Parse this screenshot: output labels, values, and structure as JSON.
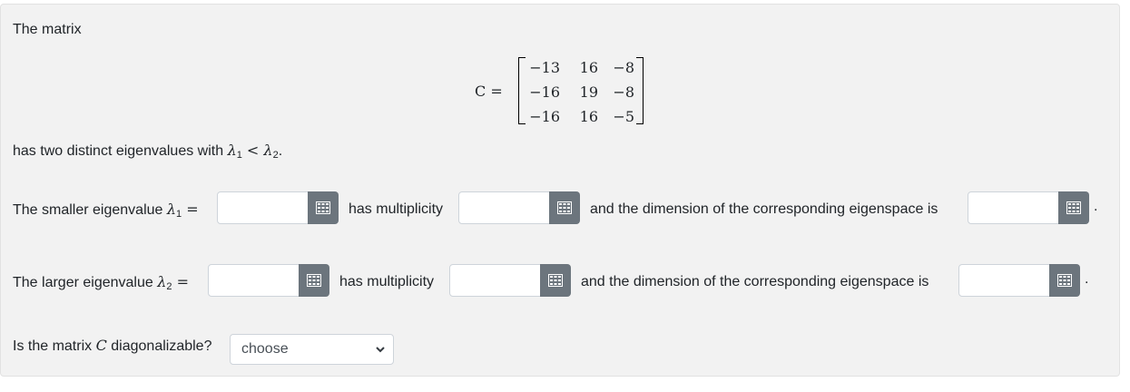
{
  "intro": "The matrix",
  "matrix": {
    "label": "C =",
    "rows": [
      [
        "−13",
        "16",
        "−8"
      ],
      [
        "−16",
        "19",
        "−8"
      ],
      [
        "−16",
        "16",
        "−5"
      ]
    ]
  },
  "eigen_text": {
    "prefix": "has two distinct eigenvalues with ",
    "l1": "λ",
    "l1_sub": "1",
    "lt": " < ",
    "l2": "λ",
    "l2_sub": "2",
    "suffix": "."
  },
  "row1": {
    "label": "The smaller eigenvalue ",
    "sym": "λ",
    "sub": "1",
    "eq": " =",
    "mult": "has multiplicity",
    "dim": "and the dimension of the corresponding eigenspace is",
    "end": "."
  },
  "row2": {
    "label": "The larger eigenvalue ",
    "sym": "λ",
    "sub": "2",
    "eq": " =",
    "mult": "has multiplicity",
    "dim": "and the dimension of the corresponding eigenspace is",
    "end": "."
  },
  "question": {
    "label": "Is the matrix ",
    "sym": "C",
    "rest": " diagonalizable?",
    "select_value": "choose"
  },
  "icons": {
    "keypad": "keypad-icon",
    "chevron": "chevron-down-icon"
  },
  "colors": {
    "button": "#6c757d",
    "card": "#f2f2f2"
  }
}
